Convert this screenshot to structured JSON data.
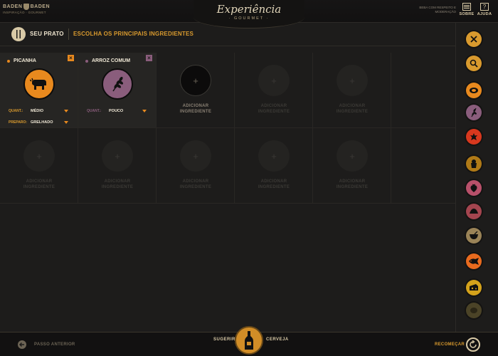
{
  "brand": {
    "name_left": "BADEN",
    "name_right": "BADEN",
    "tagline": "INSPIRAÇÃO · GOURMET"
  },
  "logo": {
    "title": "Experiência",
    "subtitle": "· GOURMET ·"
  },
  "header": {
    "warning": "BEBA COM RESPEITO E MODERAÇÃO",
    "about_label": "SOBRE",
    "help_label": "AJUDA",
    "help_icon": "?"
  },
  "page": {
    "section_label": "SEU PRATO",
    "step_title": "ESCOLHA OS PRINCIPAIS INGREDIENTES"
  },
  "ingredients": [
    {
      "name": "PICANHA",
      "color": "#e8891e",
      "icon": "cow-icon",
      "qty_label": "QUANT.:",
      "qty_value": "MÉDIO",
      "prep_label": "PREPARO:",
      "prep_value": "GRELHADO"
    },
    {
      "name": "ARROZ COMUM",
      "color": "#8a5d7c",
      "icon": "wheat-icon",
      "qty_label": "QUANT.:",
      "qty_value": "POUCO"
    }
  ],
  "add_slot": {
    "plus": "+",
    "label_line1": "ADICIONAR",
    "label_line2": "INGREDIENTE"
  },
  "categories": [
    {
      "name": "close",
      "color": "#d99a2e",
      "glyph": "✕"
    },
    {
      "name": "search",
      "color": "#d99a2e",
      "glyph": "🔍"
    },
    {
      "name": "meat",
      "color": "#e8891e",
      "glyph": ""
    },
    {
      "name": "grains",
      "color": "#8a5d7c",
      "glyph": ""
    },
    {
      "name": "vegetables",
      "color": "#d8381e",
      "glyph": ""
    },
    {
      "name": "desserts",
      "color": "#b07a17",
      "glyph": ""
    },
    {
      "name": "fruits",
      "color": "#b8506a",
      "glyph": ""
    },
    {
      "name": "breads",
      "color": "#a4454f",
      "glyph": ""
    },
    {
      "name": "sauces",
      "color": "#9a8357",
      "glyph": ""
    },
    {
      "name": "fish",
      "color": "#e86a1e",
      "glyph": ""
    },
    {
      "name": "cheese",
      "color": "#d4a21b",
      "glyph": ""
    },
    {
      "name": "herbs",
      "color": "#4b4327",
      "glyph": ""
    }
  ],
  "footer": {
    "prev_label": "PASSO ANTERIOR",
    "suggest_left": "SUGERIR",
    "suggest_right": "CERVEJA",
    "restart_label": "RECOMEÇAR"
  }
}
